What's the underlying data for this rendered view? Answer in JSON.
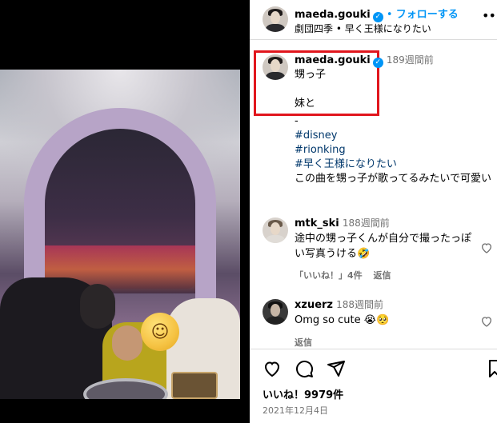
{
  "header": {
    "username": "maeda.gouki",
    "separator": "•",
    "follow_label": "フォローする",
    "subtitle": "劇団四季 • 早く王様になりたい",
    "more_label": "•••"
  },
  "caption": {
    "username": "maeda.gouki",
    "time": "189週間前",
    "line1": "甥っ子",
    "line2": "妹と",
    "dash": "-",
    "hashtags": [
      "#disney",
      "#rionking",
      "#早く王様になりたい"
    ],
    "line3": "この曲を甥っ子が歌ってるみたいで可愛い"
  },
  "comments": [
    {
      "username": "mtk_ski",
      "time": "188週間前",
      "text": "途中の甥っ子くんが自分で撮ったっぽい写真うける🤣",
      "likes_label": "「いいね！」4件",
      "reply_label": "返信"
    },
    {
      "username": "xzuerz",
      "time": "188週間前",
      "text": "Omg so cute 😭🥺",
      "reply_label": "返信"
    }
  ],
  "footer": {
    "likes": "いいね！9979件",
    "date": "2021年12月4日"
  },
  "icons": {
    "verified": "verified-badge-icon",
    "heart": "heart-icon",
    "comment": "comment-icon",
    "share": "share-icon",
    "save": "bookmark-icon"
  },
  "colors": {
    "accent_blue": "#0095f6",
    "highlight_red": "#e1161d",
    "muted": "#737373"
  }
}
